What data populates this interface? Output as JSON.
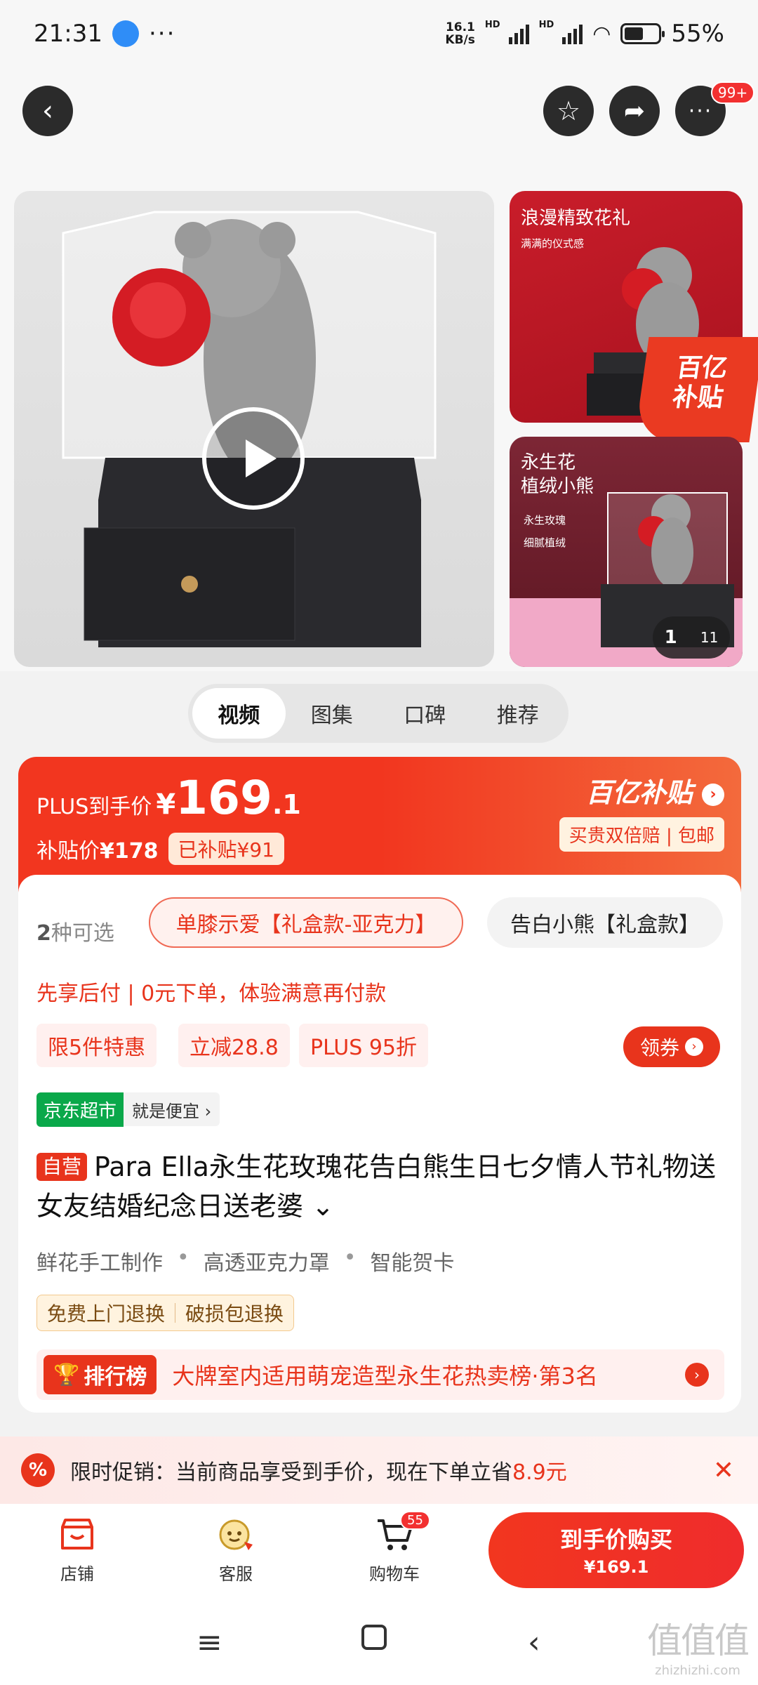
{
  "status_bar": {
    "time": "21:31",
    "more": "···",
    "speed_value": "16.1",
    "speed_unit": "KB/s",
    "hd": "HD",
    "battery": "55%"
  },
  "header": {
    "back_glyph": "‹",
    "star_glyph": "☆",
    "share_glyph": "➦",
    "more_glyph": "···",
    "more_badge": "99+"
  },
  "gallery": {
    "side1_title": "浪漫精致花礼",
    "side1_sub": "满满的仪式感",
    "subsidy_corner": "百亿\n补贴",
    "side2_title": "永生花\n植绒小熊",
    "side2_point1": "永生玫瑰",
    "side2_point2": "细腻植绒",
    "pager_current": "1",
    "pager_total": "11"
  },
  "media_tabs": [
    {
      "label": "视频",
      "active": true
    },
    {
      "label": "图集",
      "active": false
    },
    {
      "label": "口碑",
      "active": false
    },
    {
      "label": "推荐",
      "active": false
    }
  ],
  "price": {
    "plus_label": "PLUS到手价",
    "currency": "¥",
    "int": "169",
    "dec": ".1",
    "subsidy_label": "补贴价",
    "subsidy_price": "¥178",
    "subsidy_tag": "已补贴¥91",
    "brand_logo": "百亿补贴",
    "brand_arrow": "›",
    "guarantee": "买贵双倍赔 | 包邮"
  },
  "options": {
    "count_num": "2",
    "count_text": "种可选",
    "opt1": "单膝示爱【礼盒款-亚克力】",
    "opt2": "告白小熊【礼盒款】"
  },
  "bnpl": "先享后付 | 0元下单，体验满意再付款",
  "promos": [
    "限5件特惠",
    "立减28.8",
    "PLUS 95折"
  ],
  "coupon": {
    "label": "领券",
    "arrow": "›"
  },
  "jd_tag": {
    "tag": "京东超市",
    "text": "就是便宜 ›"
  },
  "title": {
    "self_tag": "自营",
    "text": "Para Ella永生花玫瑰花告白熊生日七夕情人节礼物送女友结婚纪念日送老婆 ⌄"
  },
  "features": [
    "鲜花手工制作",
    "高透亚克力罩",
    "智能贺卡"
  ],
  "returns": [
    "免费上门退换",
    "破损包退换"
  ],
  "rank": {
    "tag": "排行榜",
    "text": "大牌室内适用萌宠造型永生花热卖榜·第3名",
    "arrow": "›"
  },
  "notice": {
    "icon": "%",
    "text": "限时促销：当前商品享受到手价，现在下单立省",
    "saving": "8.9元",
    "close": "✕"
  },
  "bottom_bar": {
    "shop": "店铺",
    "service": "客服",
    "cart": "购物车",
    "cart_badge": "55",
    "buy_label": "到手价购买",
    "buy_price": "¥169.1"
  },
  "nav": {
    "menu": "≡",
    "back": "‹"
  },
  "watermark": {
    "logo": "值值值",
    "url": "zhizhizhi.com"
  },
  "colors": {
    "accent": "#e8341c",
    "price_banner": "#f2361f",
    "jd_green": "#0aa84a"
  }
}
